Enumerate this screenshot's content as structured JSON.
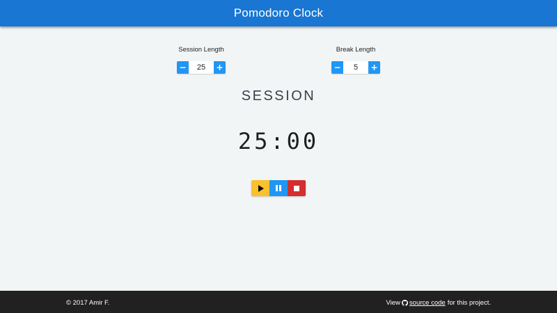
{
  "header": {
    "title": "Pomodoro Clock"
  },
  "session_setting": {
    "label": "Session Length",
    "value": "25",
    "decrement": "−",
    "increment": "+"
  },
  "break_setting": {
    "label": "Break Length",
    "value": "5",
    "decrement": "−",
    "increment": "+"
  },
  "timer": {
    "mode": "SESSION",
    "time": "25:00"
  },
  "controls": {
    "play_icon": "play-icon",
    "pause_icon": "pause-icon",
    "stop_icon": "stop-icon"
  },
  "footer": {
    "copyright": "© 2017 Amir F.",
    "prefix": "View",
    "link_text": "source code",
    "link_icon": "github-icon",
    "suffix": "for this project."
  },
  "colors": {
    "primary": "#1976d2",
    "accent": "#2196f3",
    "play": "#fbc02d",
    "stop": "#d32f2f",
    "footer": "#212121",
    "background": "#f2f5f6"
  }
}
